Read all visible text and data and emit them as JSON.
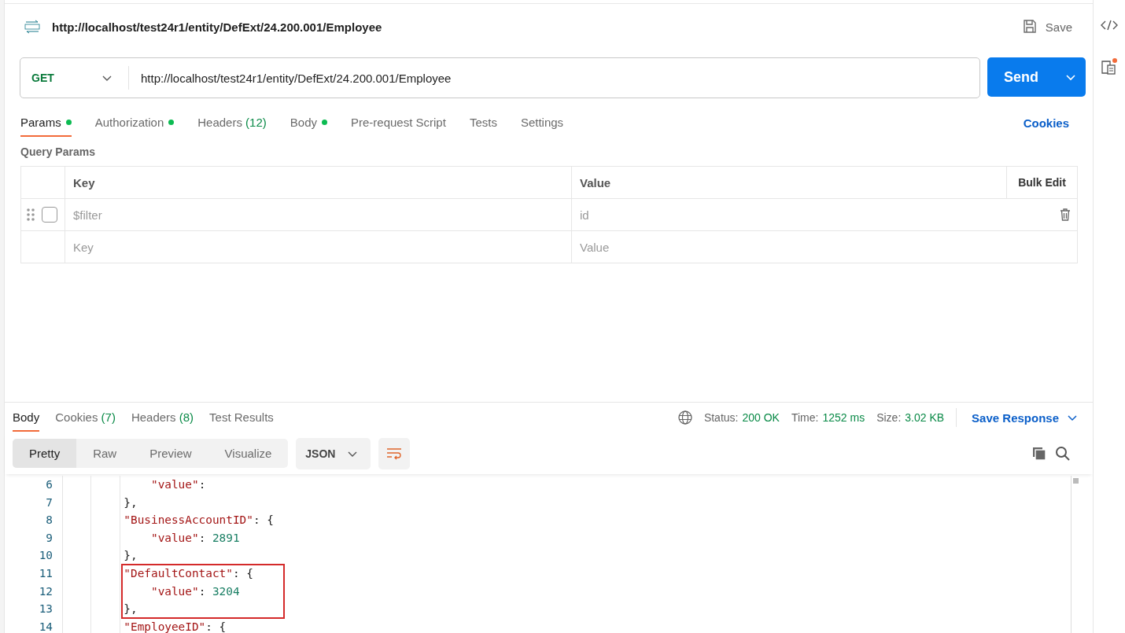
{
  "request": {
    "title": "http://localhost/test24r1/entity/DefExt/24.200.001/Employee",
    "save_label": "Save",
    "method": "GET",
    "url": "http://localhost/test24r1/entity/DefExt/24.200.001/Employee",
    "send_label": "Send"
  },
  "request_tabs": [
    {
      "label": "Params",
      "dot": true,
      "selected": true
    },
    {
      "label": "Authorization",
      "dot": true,
      "selected": false
    },
    {
      "label": "Headers",
      "count": "(12)",
      "dot": false,
      "selected": false
    },
    {
      "label": "Body",
      "dot": true,
      "selected": false
    },
    {
      "label": "Pre-request Script",
      "dot": false,
      "selected": false
    },
    {
      "label": "Tests",
      "dot": false,
      "selected": false
    },
    {
      "label": "Settings",
      "dot": false,
      "selected": false
    }
  ],
  "cookies_link": "Cookies",
  "query_params": {
    "title": "Query Params",
    "columns": [
      "Key",
      "Value"
    ],
    "bulk_edit": "Bulk Edit",
    "rows": [
      {
        "key_placeholder": "$filter",
        "value_placeholder": "id",
        "checked": false,
        "kind": "param"
      },
      {
        "key_placeholder": "Key",
        "value_placeholder": "Value",
        "kind": "new"
      }
    ]
  },
  "response_tabs": [
    {
      "label": "Body",
      "selected": true
    },
    {
      "label": "Cookies",
      "count": "(7)",
      "selected": false
    },
    {
      "label": "Headers",
      "count": "(8)",
      "selected": false
    },
    {
      "label": "Test Results",
      "selected": false
    }
  ],
  "status": {
    "status_label": "Status:",
    "status_value": "200 OK",
    "time_label": "Time:",
    "time_value": "1252 ms",
    "size_label": "Size:",
    "size_value": "3.02 KB",
    "save_response": "Save Response"
  },
  "view_modes": [
    {
      "label": "Pretty",
      "selected": true
    },
    {
      "label": "Raw",
      "selected": false
    },
    {
      "label": "Preview",
      "selected": false
    },
    {
      "label": "Visualize",
      "selected": false
    }
  ],
  "format": "JSON",
  "code_lines": [
    {
      "number": "6",
      "highlighted": false,
      "parts": [
        {
          "kind": "key",
          "text": "            \"value\""
        },
        {
          "kind": "punct",
          "text": ":"
        }
      ]
    },
    {
      "number": "7",
      "highlighted": false,
      "parts": [
        {
          "kind": "punct",
          "text": "        },"
        }
      ]
    },
    {
      "number": "8",
      "highlighted": false,
      "parts": [
        {
          "kind": "key",
          "text": "        \"BusinessAccountID\""
        },
        {
          "kind": "punct",
          "text": ": {"
        }
      ]
    },
    {
      "number": "9",
      "highlighted": false,
      "parts": [
        {
          "kind": "key",
          "text": "            \"value\""
        },
        {
          "kind": "punct",
          "text": ": "
        },
        {
          "kind": "number",
          "text": "2891"
        }
      ]
    },
    {
      "number": "10",
      "highlighted": false,
      "parts": [
        {
          "kind": "punct",
          "text": "        },"
        }
      ]
    },
    {
      "number": "11",
      "highlighted": true,
      "parts": [
        {
          "kind": "key",
          "text": "        \"DefaultContact\""
        },
        {
          "kind": "punct",
          "text": ": {"
        }
      ]
    },
    {
      "number": "12",
      "highlighted": true,
      "parts": [
        {
          "kind": "key",
          "text": "            \"value\""
        },
        {
          "kind": "punct",
          "text": ": "
        },
        {
          "kind": "number",
          "text": "3204"
        }
      ]
    },
    {
      "number": "13",
      "highlighted": true,
      "parts": [
        {
          "kind": "punct",
          "text": "        },"
        }
      ]
    },
    {
      "number": "14",
      "highlighted": false,
      "parts": [
        {
          "kind": "key",
          "text": "        \"EmployeeID\""
        },
        {
          "kind": "punct",
          "text": ": {"
        }
      ]
    }
  ]
}
